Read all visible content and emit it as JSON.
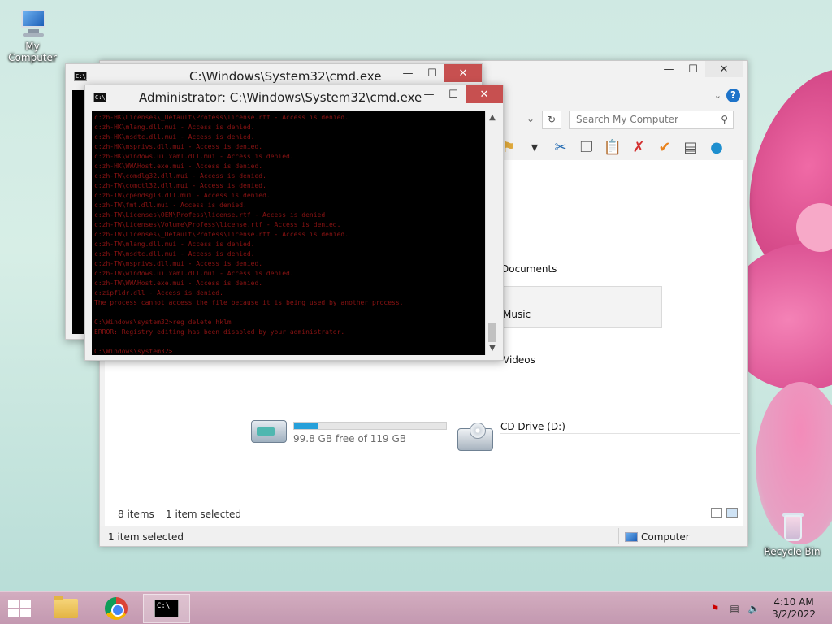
{
  "desktop": {
    "icons": [
      {
        "label": "My Computer",
        "icon": "computer-icon"
      },
      {
        "label": "Recycle Bin",
        "icon": "recycle-bin-icon"
      }
    ]
  },
  "explorer": {
    "search_placeholder": "Search My Computer",
    "items": [
      {
        "label": "Documents"
      },
      {
        "label": "Music"
      },
      {
        "label": "Videos"
      }
    ],
    "drives": [
      {
        "label": "",
        "free_text": "99.8 GB free of 119 GB",
        "used_fraction": 0.16
      },
      {
        "label": "CD Drive (D:)"
      }
    ],
    "item_count": "8 items",
    "selected_text": "1 item selected",
    "status_left": "1 item selected",
    "status_right": "Computer",
    "caption_min": "—",
    "caption_max": "☐",
    "caption_close": "✕"
  },
  "cmd_back": {
    "title": "C:\\Windows\\System32\\cmd.exe",
    "caption_min": "—",
    "caption_max": "☐",
    "caption_close": "✕"
  },
  "cmd_front": {
    "title": "Administrator: C:\\Windows\\System32\\cmd.exe",
    "caption_min": "—",
    "caption_max": "☐",
    "caption_close": "✕",
    "lines": [
      "c:zh-HK\\Licenses\\_Default\\Profess\\license.rtf - Access is denied.",
      "c:zh-HK\\mlang.dll.mui - Access is denied.",
      "c:zh-HK\\msdtc.dll.mui - Access is denied.",
      "c:zh-HK\\msprivs.dll.mui - Access is denied.",
      "c:zh-HK\\windows.ui.xaml.dll.mui - Access is denied.",
      "c:zh-HK\\WWAHost.exe.mui - Access is denied.",
      "c:zh-TW\\comdlg32.dll.mui - Access is denied.",
      "c:zh-TW\\comctl32.dll.mui - Access is denied.",
      "c:zh-TW\\cpendsgl3.dll.mui - Access is denied.",
      "c:zh-TW\\fmt.dll.mui - Access is denied.",
      "c:zh-TW\\Licenses\\OEM\\Profess\\license.rtf - Access is denied.",
      "c:zh-TW\\Licenses\\Volume\\Profess\\license.rtf - Access is denied.",
      "c:zh-TW\\Licenses\\_Default\\Profess\\license.rtf - Access is denied.",
      "c:zh-TW\\mlang.dll.mui - Access is denied.",
      "c:zh-TW\\msdtc.dll.mui - Access is denied.",
      "c:zh-TW\\msprivs.dll.mui - Access is denied.",
      "c:zh-TW\\windows.ui.xaml.dll.mui - Access is denied.",
      "c:zh-TW\\WWAHost.exe.mui - Access is denied.",
      "c:zipfldr.dll - Access is denied.",
      "The process cannot access the file because it is being used by another process.",
      "",
      "C:\\Windows\\system32>reg delete hklm",
      "ERROR: Registry editing has been disabled by your administrator.",
      "",
      "C:\\Windows\\system32>"
    ]
  },
  "taskbar": {
    "apps": [
      {
        "name": "file-explorer",
        "active": false
      },
      {
        "name": "chrome",
        "active": false
      },
      {
        "name": "command-prompt",
        "active": true
      }
    ],
    "time": "4:10 AM",
    "date": "3/2/2022"
  }
}
